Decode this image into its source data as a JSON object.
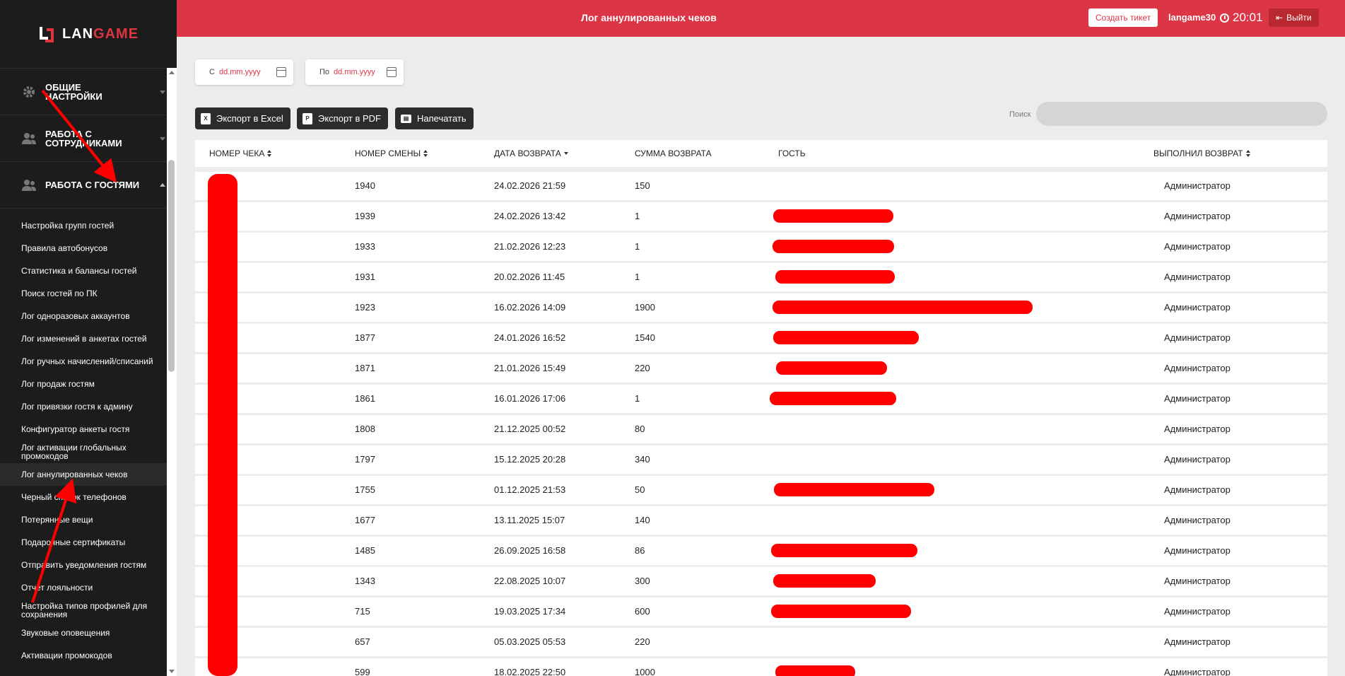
{
  "app": {
    "logo_text_white": "LAN",
    "logo_text_red": "GAME"
  },
  "header": {
    "title": "Лог аннулированных чеков",
    "ticket_button": "Создать тикет",
    "username": "langame30",
    "time": "20:01",
    "exit_button": "Выйти"
  },
  "sidebar": {
    "sections": [
      {
        "label": "Общие настройки",
        "icon": "gear-icon",
        "expanded": false
      },
      {
        "label": "Работа с сотрудниками",
        "icon": "users-icon",
        "expanded": false
      },
      {
        "label": "Работа с гостями",
        "icon": "users-icon",
        "expanded": true
      }
    ],
    "items": [
      "Настройка групп гостей",
      "Правила автобонусов",
      "Статистика и балансы гостей",
      "Поиск гостей по ПК",
      "Лог одноразовых аккаунтов",
      "Лог изменений в анкетах гостей",
      "Лог ручных начислений/списаний",
      "Лог продаж гостям",
      "Лог привязки гостя к админу",
      "Конфигуратор анкеты гостя",
      "Лог активации глобальных промокодов",
      "Лог аннулированных чеков",
      "Черный список телефонов",
      "Потерянные вещи",
      "Подарочные сертификаты",
      "Отправить уведомления гостям",
      "Отчет лояльности",
      "Настройка типов профилей для сохранения",
      "Звуковые оповещения",
      "Активации промокодов"
    ],
    "active_item": "Лог аннулированных чеков"
  },
  "filters": {
    "from_prefix": "С",
    "from_placeholder": "dd.mm.yyyy",
    "to_prefix": "По",
    "to_placeholder": "dd.mm.yyyy"
  },
  "actions": {
    "excel": "Экспорт в Excel",
    "pdf": "Экспорт в PDF",
    "print": "Напечатать",
    "search_label": "Поиск"
  },
  "table": {
    "columns": [
      "Номер чека",
      "Номер смены",
      "Дата возврата",
      "Сумма возврата",
      "Гость",
      "Выполнил возврат"
    ],
    "rows": [
      {
        "shift": "1940",
        "date": "24.02.2026 21:59",
        "amount": "150",
        "by": "Администратор"
      },
      {
        "shift": "1939",
        "date": "24.02.2026 13:42",
        "amount": "1",
        "by": "Администратор"
      },
      {
        "shift": "1933",
        "date": "21.02.2026 12:23",
        "amount": "1",
        "by": "Администратор"
      },
      {
        "shift": "1931",
        "date": "20.02.2026 11:45",
        "amount": "1",
        "by": "Администратор"
      },
      {
        "shift": "1923",
        "date": "16.02.2026 14:09",
        "amount": "1900",
        "by": "Администратор"
      },
      {
        "shift": "1877",
        "date": "24.01.2026 16:52",
        "amount": "1540",
        "by": "Администратор"
      },
      {
        "shift": "1871",
        "date": "21.01.2026 15:49",
        "amount": "220",
        "by": "Администратор"
      },
      {
        "shift": "1861",
        "date": "16.01.2026 17:06",
        "amount": "1",
        "by": "Администратор"
      },
      {
        "shift": "1808",
        "date": "21.12.2025 00:52",
        "amount": "80",
        "by": "Администратор"
      },
      {
        "shift": "1797",
        "date": "15.12.2025 20:28",
        "amount": "340",
        "by": "Администратор"
      },
      {
        "shift": "1755",
        "date": "01.12.2025 21:53",
        "amount": "50",
        "by": "Администратор"
      },
      {
        "shift": "1677",
        "date": "13.11.2025 15:07",
        "amount": "140",
        "by": "Администратор"
      },
      {
        "shift": "1485",
        "date": "26.09.2025 16:58",
        "amount": "86",
        "by": "Администратор"
      },
      {
        "shift": "1343",
        "date": "22.08.2025 10:07",
        "amount": "300",
        "by": "Администратор"
      },
      {
        "shift": "715",
        "date": "19.03.2025 17:34",
        "amount": "600",
        "by": "Администратор"
      },
      {
        "shift": "657",
        "date": "05.03.2025 05:53",
        "amount": "220",
        "by": "Администратор"
      },
      {
        "shift": "599",
        "date": "18.02.2025 22:50",
        "amount": "1000",
        "by": "Администратор"
      }
    ]
  },
  "colors": {
    "header": "#dc3545",
    "sidebar": "#1c1c1c",
    "redaction": "#ff0000"
  }
}
